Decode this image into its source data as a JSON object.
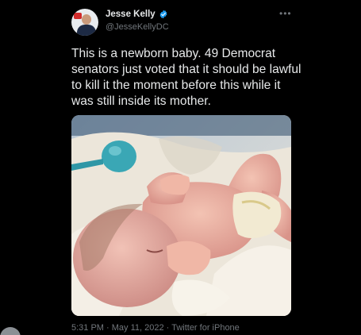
{
  "author": {
    "display_name": "Jesse Kelly",
    "handle": "@JesseKellyDC",
    "verified": true,
    "verified_icon": "verified-badge-icon"
  },
  "menu_icon": "more-icon",
  "tweet": {
    "text": "This is a newborn baby. 49 Democrat senators just voted that it should be lawful to kill it the moment before this while it was still inside its mother."
  },
  "media": {
    "type": "photo"
  },
  "meta": {
    "time": "5:31 PM",
    "date": "May 11, 2022",
    "source": "Twitter for iPhone",
    "separator": "·"
  },
  "colors": {
    "background": "#000000",
    "text_primary": "#e7e9ea",
    "text_secondary": "#71767b",
    "verified": "#1d9bf0"
  }
}
